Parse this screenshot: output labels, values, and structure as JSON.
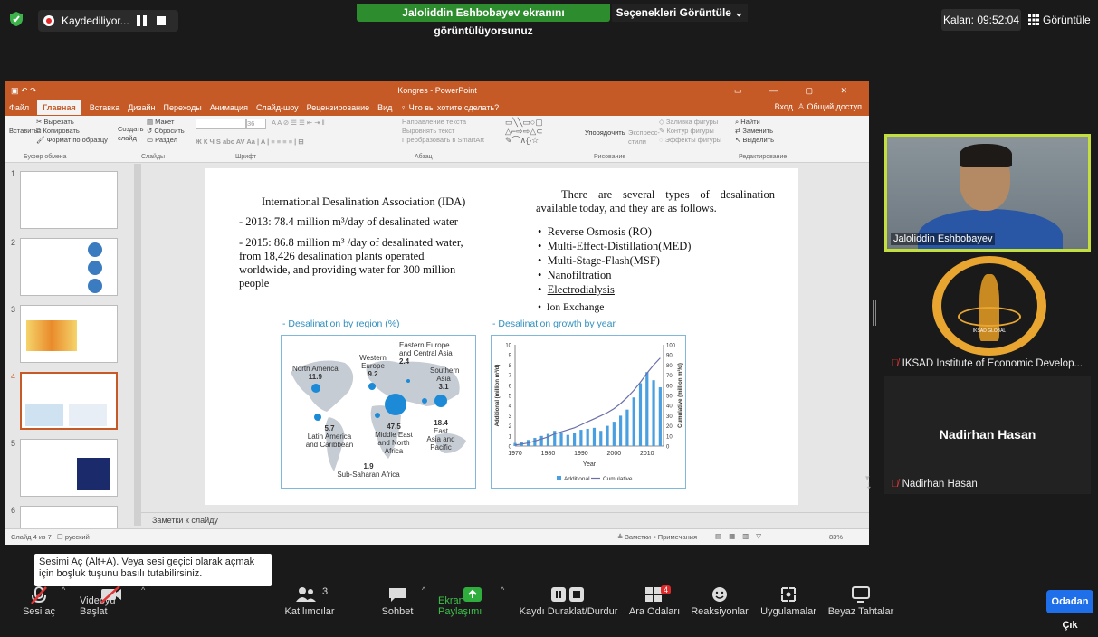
{
  "topbar": {
    "recording_label": "Kaydediliyor...",
    "share_banner": "Jaloliddin Eshbobayev  ekranını görüntülüyorsunuz",
    "view_options": "Seçenekleri Görüntüle",
    "timer": "Kalan: 09:52:04",
    "view_button": "Görüntüle"
  },
  "ppt": {
    "window_title": "Kongres - PowerPoint",
    "tabs": [
      "Файл",
      "Главная",
      "Вставка",
      "Дизайн",
      "Переходы",
      "Анимация",
      "Слайд-шоу",
      "Рецензирование",
      "Вид",
      "Что вы хотите сделать?"
    ],
    "account": "Вход",
    "share": "Общий доступ",
    "ribbon": {
      "cut": "Вырезать",
      "copy": "Копировать",
      "paste": "Вставить",
      "format_painter": "Формат по образцу",
      "layout": "Макет",
      "reset": "Сбросить",
      "new_slide": "Создать слайд",
      "section": "Раздел",
      "text_dir": "Направление текста",
      "align_text": "Выровнять текст",
      "smartart": "Преобразовать в SmartArt",
      "arrange": "Упорядочить",
      "quick_styles": "Экспресс-стили",
      "fill": "Заливка фигуры",
      "outline": "Контур фигуры",
      "effects": "Эффекты фигуры",
      "find": "Найти",
      "replace": "Заменить",
      "select": "Выделить",
      "caps": [
        "Буфер обмена",
        "Слайды",
        "Шрифт",
        "Абзац",
        "Рисование",
        "Редактирование"
      ],
      "font_size": "36"
    },
    "slide": {
      "left_title": "International Desalination Association (IDA)",
      "left_p1": "- 2013: 78.4 million m³/day of desalinated water",
      "left_p2": "- 2015: 86.8 million m³ /day of desalinated water, from 18,426 desalination plants operated worldwide, and providing water for 300 million people",
      "right_intro": "There are several types of desalination available today, and they are as follows.",
      "bullets": [
        "Reverse Osmosis (RO)",
        "Multi-Effect-Distillation(MED)",
        "Multi-Stage-Flash(MSF)",
        "Nanofiltration",
        "Electrodialysis",
        "Ion Exchange"
      ],
      "map_title": "- Desalination by region (%)",
      "map_labels": {
        "na": "North America",
        "na_v": "11.9",
        "we": "Western Europe",
        "we_v": "9.2",
        "ee": "Eastern Europe and Central Asia",
        "ee_v": "2.4",
        "sa": "Southern Asia",
        "sa_v": "3.1",
        "lac": "Latin America and Caribbean",
        "lac_v": "5.7",
        "me": "Middle East and North Africa",
        "me_v": "47.5",
        "ea": "East Asia and Pacific",
        "ea_v": "18.4",
        "ssa": "Sub-Saharan Africa",
        "ssa_v": "1.9"
      },
      "chart_title": "- Desalination growth by year"
    },
    "notes": "Заметки к слайду",
    "status_left": "Слайд 4 из 7",
    "status_lang": "русский",
    "status_notes": "Заметки",
    "status_comments": "Примечания",
    "zoom": "83%"
  },
  "chart_data": {
    "type": "bar",
    "title": "",
    "xlabel": "Year",
    "ylabel": "Additional (million m³/d)",
    "y2label": "Cumulative (million m³/d)",
    "x": [
      1970,
      1972,
      1974,
      1976,
      1978,
      1980,
      1982,
      1984,
      1986,
      1988,
      1990,
      1992,
      1994,
      1996,
      1998,
      2000,
      2002,
      2004,
      2006,
      2008,
      2010,
      2012,
      2014
    ],
    "series": [
      {
        "name": "Additional",
        "values": [
          0.3,
          0.4,
          0.6,
          0.8,
          1.0,
          1.2,
          1.5,
          1.3,
          1.1,
          1.3,
          1.6,
          1.7,
          1.8,
          1.5,
          2.0,
          2.4,
          3.0,
          3.6,
          4.8,
          6.2,
          7.3,
          6.5,
          5.8
        ]
      },
      {
        "name": "Cumulative",
        "values": [
          1,
          2,
          3,
          5,
          7,
          9,
          12,
          14,
          16,
          18,
          21,
          24,
          27,
          30,
          33,
          37,
          42,
          48,
          55,
          63,
          72,
          80,
          87
        ]
      }
    ],
    "xlim": [
      1970,
      2015
    ],
    "ylim": [
      0,
      10
    ],
    "y2lim": [
      0,
      100
    ],
    "xticks": [
      "1970",
      "1980",
      "1990",
      "2000",
      "2010"
    ],
    "yticks": [
      "0",
      "1",
      "2",
      "3",
      "4",
      "5",
      "6",
      "7",
      "8",
      "9",
      "10"
    ],
    "y2ticks": [
      "0",
      "10",
      "20",
      "30",
      "40",
      "50",
      "60",
      "70",
      "80",
      "90",
      "100"
    ],
    "legend": "bottom-center"
  },
  "participants": {
    "speaker": "Jaloliddin Eshbobayev",
    "iksad": "IKSAD Institute of Economic Develop...",
    "nadir_center": "Nadirhan Hasan",
    "nadir_label": "Nadirhan Hasan",
    "logo_text": "IKSAD GLOBAL"
  },
  "toolbar": {
    "tooltip": "Sesimi Aç (Alt+A). Veya sesi geçici olarak açmak için boşluk tuşunu basılı tutabilirsiniz.",
    "audio": "Sesi aç",
    "video": "Videoyu Başlat",
    "participants": "Katılımcılar",
    "participants_count": "3",
    "chat": "Sohbet",
    "share": "Ekran Paylaşımı",
    "record": "Kaydı Duraklat/Durdur",
    "breakout": "Ara Odaları",
    "breakout_badge": "4",
    "reactions": "Reaksiyonlar",
    "apps": "Uygulamalar",
    "whiteboard": "Beyaz Tahtalar",
    "leave": "Odadan Çık"
  }
}
